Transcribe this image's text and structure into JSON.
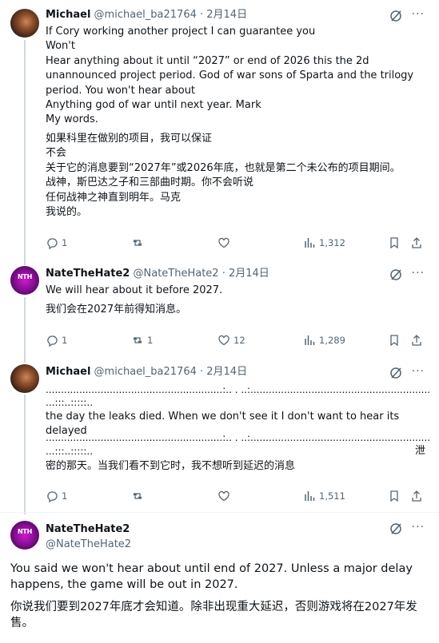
{
  "tweets": [
    {
      "name": "Michael",
      "handle": "@michael_ba21764 · 2月14日",
      "lines_en": [
        "If Cory working another project I can guarantee you",
        "Won't",
        "Hear anything about it until “2027” or end of 2026 this the 2d",
        "unannounced project period. God of war sons of Sparta and the trilogy",
        "period. You won't hear about",
        "Anything god of war until next year. Mark",
        "My words."
      ],
      "lines_zh": [
        "如果科里在做别的项目，我可以保证",
        "不会",
        "关于它的消息要到“2027年”或2026年底，也就是第二个未公布的项目期间。",
        "战神，斯巴达之子和三部曲时期。你不会听说",
        "任何战神之神直到明年。马克",
        "我说的。"
      ],
      "replies": "1",
      "reposts": "",
      "likes": "",
      "views": "1,312"
    },
    {
      "name": "NateTheHate2",
      "handle": "@NateTheHate2 · 2月14日",
      "line_en": "We will hear about it before 2027.",
      "line_zh": "我们会在2027年前得知消息。",
      "replies": "1",
      "reposts": "1",
      "likes": "12",
      "views": "1,289"
    },
    {
      "name": "Michael",
      "handle": "@michael_ba21764 · 2月14日",
      "dots1": "..........................................................:.. . ..:...........................................................................................",
      "dots2": "...:::..:::::..",
      "line_en": "the day the leaks died. When we don't see it I don't want to hear its delayed",
      "dots3": "..........................................................:.. . ..:...........................................................................................",
      "dots4": "...:::..:::::..",
      "zh_tail": "泄",
      "line_zh": "密的那天。当我们看不到它时，我不想听到延迟的消息",
      "replies": "1",
      "reposts": "",
      "likes": "",
      "views": "1,511"
    },
    {
      "name": "NateTheHate2",
      "handle": "@NateTheHate2",
      "text_en": "You said we won't hear about until end of 2027. Unless a major delay happens, the game will be out in 2027.",
      "text_zh": "你说我们要到2027年底才会知道。除非出现重大延迟，否则游戏将在2027年发售。"
    }
  ],
  "avatar_text": "NTH",
  "more_label": "···"
}
